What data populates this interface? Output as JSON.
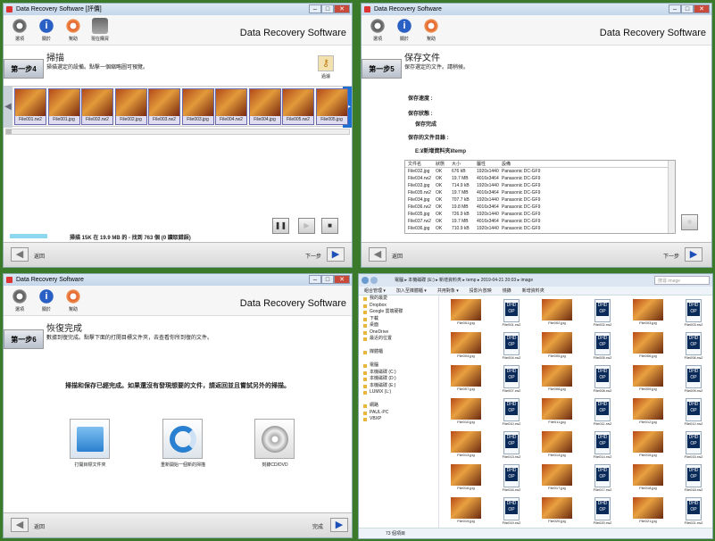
{
  "common": {
    "brand": "Data Recovery Software",
    "tool_options": "選項",
    "tool_info": "關於",
    "tool_help": "幫助",
    "tool_cart": "現在購買",
    "back": "返回",
    "next": "下一步",
    "finish": "完成"
  },
  "w1": {
    "title": "Data Recovery Software [評價]",
    "step": "第一步4",
    "heading": "掃描",
    "desc": "掃描選定的設備。點擊一個縮略圖可預覽。",
    "filter": "過濾",
    "status": "掃描 15K 在 19.9 MB 的 - 找到 763 個 (0 讀取錯誤)",
    "thumbs": [
      "File001.rw2",
      "File001.jpg",
      "File002.rw2",
      "File002.jpg",
      "File003.rw2",
      "File003.jpg",
      "File004.rw2",
      "File004.jpg",
      "File005.rw2",
      "File005.jpg"
    ]
  },
  "w2": {
    "title": "Data Recovery Software",
    "step": "第一步5",
    "heading": "保存文件",
    "desc": "保存選定的文件。請稍候。",
    "l_speed": "保存速度 :",
    "l_status": "保存狀態 :",
    "v_status": "保存完成",
    "l_dir": "保存的文件目錄 :",
    "v_dir": "E:¥新增資料夾¥temp",
    "cols": [
      "文件名",
      "狀態",
      "大小",
      "屬性",
      "設備"
    ],
    "rows": [
      [
        "File032.jpg",
        "OK",
        "676 kB",
        "1920x1440",
        "Panasonic DC-GF9"
      ],
      [
        "File034.rw2",
        "OK",
        "19.7 MB",
        "4016x3464",
        "Panasonic DC-GF9"
      ],
      [
        "File033.jpg",
        "OK",
        "714.9 kB",
        "1920x1440",
        "Panasonic DC-GF9"
      ],
      [
        "File035.rw2",
        "OK",
        "19.7 MB",
        "4016x3464",
        "Panasonic DC-GF9"
      ],
      [
        "File034.jpg",
        "OK",
        "707.7 kB",
        "1920x1440",
        "Panasonic DC-GF9"
      ],
      [
        "File036.rw2",
        "OK",
        "19.8 MB",
        "4016x3464",
        "Panasonic DC-GF9"
      ],
      [
        "File035.jpg",
        "OK",
        "726.9 kB",
        "1920x1440",
        "Panasonic DC-GF9"
      ],
      [
        "File037.rw2",
        "OK",
        "19.7 MB",
        "4016x3464",
        "Panasonic DC-GF9"
      ],
      [
        "File036.jpg",
        "OK",
        "710.9 kB",
        "1920x1440",
        "Panasonic DC-GF9"
      ]
    ]
  },
  "w3": {
    "title": "Data Recovery Software",
    "step": "第一步6",
    "heading": "恢復完成",
    "desc": "數據到復完成。點擊下面的打開目標文件夾，去查看你所到復的文件。",
    "msg": "掃描和保存已經完成。如果還沒有發現想要的文件，請返回並且嘗試另外的掃描。",
    "a1": "打開目標文件夾",
    "a2": "重新開始一個新的掃描",
    "a3": "刻錄CD/DVD"
  },
  "exp": {
    "path": "電腦 ▸ 本機磁碟 (E:) ▸ 新增資料夾 ▸ temp ▸ 2019-04-21 20:03 ▸ image",
    "search": "搜尋 image",
    "tb": [
      "組合管理 ▾",
      "加入至媒體櫃 ▾",
      "共用對象 ▾",
      "投影片放映",
      "燒錄",
      "新增資料夾"
    ],
    "side": [
      "我的最愛",
      "Dropbox",
      "Google 雲端硬碟",
      "下載",
      "桌面",
      "OneDrive",
      "最近的位置",
      "",
      "媒體櫃",
      "",
      "電腦",
      "本機磁碟 (C:)",
      "本機磁碟 (D:)",
      "本機磁碟 (E:)",
      "LUMIX (L:)",
      "",
      "網路",
      "PAUL-PC",
      "VBXP"
    ],
    "files": [
      "File001.jpg",
      "File001.rw2",
      "File002.jpg",
      "File002.rw2",
      "File003.jpg",
      "File003.rw2",
      "File004.jpg",
      "File004.rw2",
      "File005.jpg",
      "File005.rw2",
      "File006.jpg",
      "File006.rw2",
      "File007.jpg",
      "File007.rw2",
      "File008.jpg",
      "File008.rw2",
      "File009.jpg",
      "File009.rw2",
      "File010.jpg",
      "File010.rw2",
      "File011.jpg",
      "File011.rw2",
      "File012.jpg",
      "File012.rw2",
      "File013.jpg",
      "File013.rw2",
      "File014.jpg",
      "File014.rw2",
      "File015.jpg",
      "File015.rw2",
      "File016.jpg",
      "File016.rw2",
      "File017.jpg",
      "File017.rw2",
      "File018.jpg",
      "File018.rw2",
      "File019.jpg",
      "File019.rw2",
      "File020.jpg",
      "File020.rw2",
      "File021.jpg",
      "File021.rw2"
    ],
    "count": "73 個項目"
  }
}
